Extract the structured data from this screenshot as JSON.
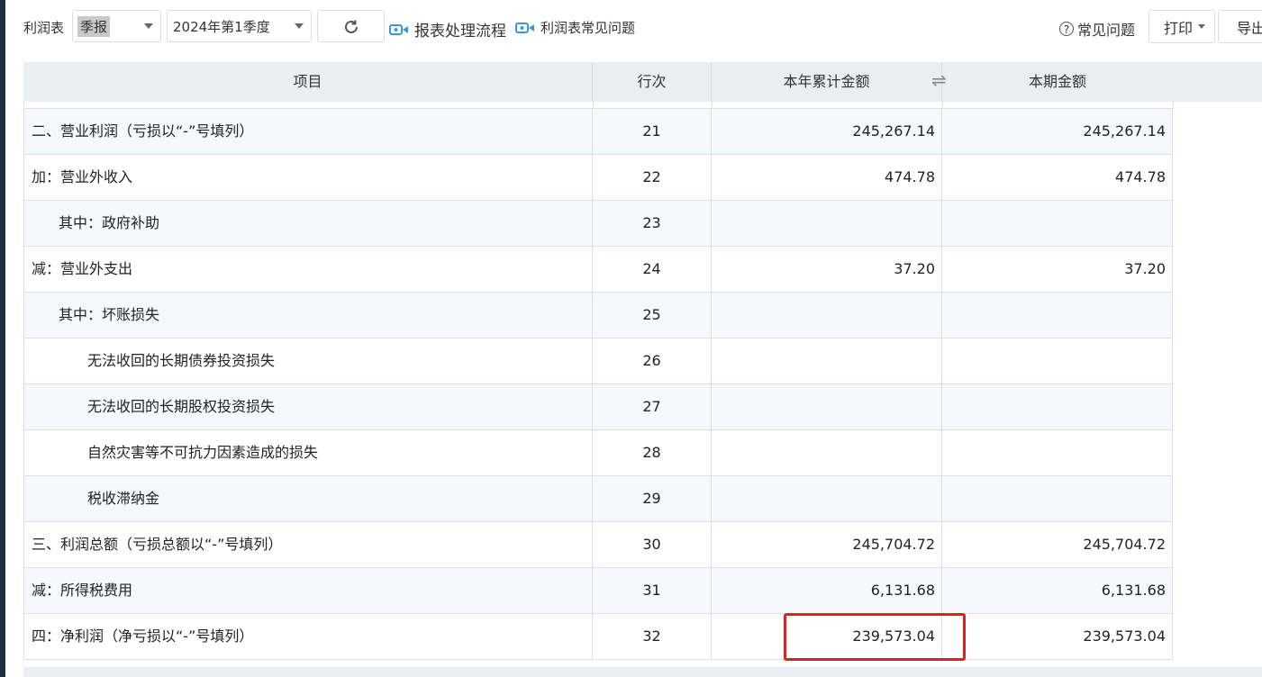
{
  "toolbar": {
    "report_name": "利润表",
    "period_type": "季报",
    "quarter": "2024年第1季度",
    "flow_link": "报表处理流程",
    "faq_link": "利润表常见问题",
    "help": "常见问题",
    "print": "打印",
    "export": "导出"
  },
  "table": {
    "headers": {
      "item": "项目",
      "line": "行次",
      "ytd": "本年累计金额",
      "period": "本期金额"
    },
    "rows": [
      {
        "item": "二、营业利润（亏损以“-”号填列）",
        "line": "21",
        "ytd": "245,267.14",
        "period": "245,267.14"
      },
      {
        "item": "加：营业外收入",
        "line": "22",
        "ytd": "474.78",
        "period": "474.78"
      },
      {
        "item": "其中：政府补助",
        "line": "23",
        "ytd": "",
        "period": ""
      },
      {
        "item": "减：营业外支出",
        "line": "24",
        "ytd": "37.20",
        "period": "37.20"
      },
      {
        "item": "其中：坏账损失",
        "line": "25",
        "ytd": "",
        "period": ""
      },
      {
        "item": "无法收回的长期债券投资损失",
        "line": "26",
        "ytd": "",
        "period": ""
      },
      {
        "item": "无法收回的长期股权投资损失",
        "line": "27",
        "ytd": "",
        "period": ""
      },
      {
        "item": "自然灾害等不可抗力因素造成的损失",
        "line": "28",
        "ytd": "",
        "period": ""
      },
      {
        "item": "税收滞纳金",
        "line": "29",
        "ytd": "",
        "period": ""
      },
      {
        "item": "三、利润总额（亏损总额以“-”号填列）",
        "line": "30",
        "ytd": "245,704.72",
        "period": "245,704.72"
      },
      {
        "item": "减：所得税费用",
        "line": "31",
        "ytd": "6,131.68",
        "period": "6,131.68"
      },
      {
        "item": "四：净利润（净亏损以“-”号填列）",
        "line": "32",
        "ytd": "239,573.04",
        "period": "239,573.04"
      }
    ]
  },
  "colors": {
    "header_bg": "#e9eef5",
    "highlight": "#e02020",
    "accent_icon": "#3a9ad9"
  }
}
